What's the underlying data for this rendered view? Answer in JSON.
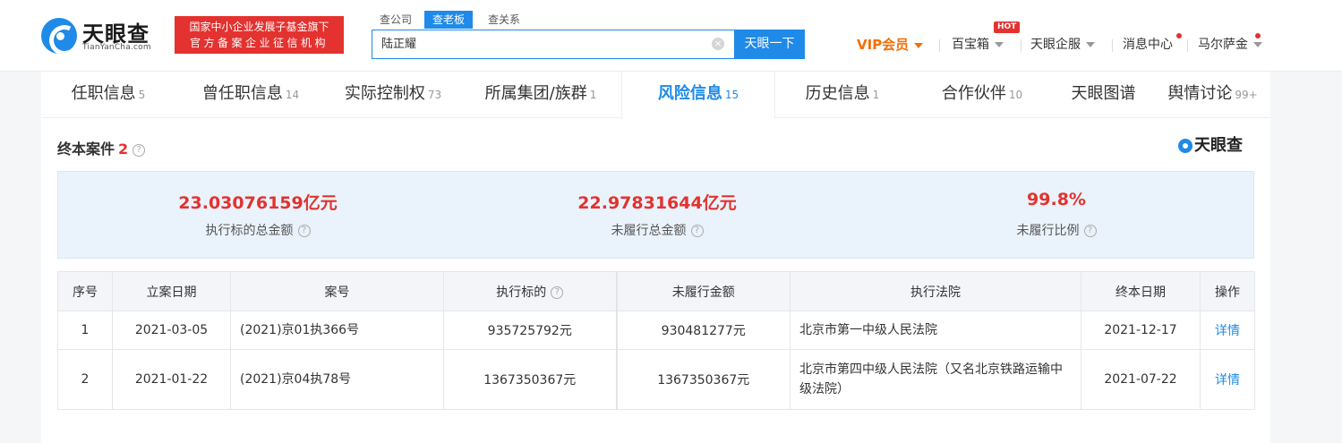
{
  "header": {
    "logo_text": "天眼查",
    "logo_sub": "TianYanCha.com",
    "badge_line1": "国家中小企业发展子基金旗下",
    "badge_line2": "官方备案企业征信机构",
    "search_tabs": [
      "查公司",
      "查老板",
      "查关系"
    ],
    "search_value": "陆正耀",
    "search_clear": "×",
    "search_button": "天眼一下",
    "nav": {
      "vip": "VIP会员",
      "toolbox": "百宝箱",
      "hot": "HOT",
      "enterprise": "天眼企服",
      "messages": "消息中心",
      "user": "马尔萨金"
    }
  },
  "tabs": [
    {
      "label": "任职信息",
      "count": "5"
    },
    {
      "label": "曾任职信息",
      "count": "14"
    },
    {
      "label": "实际控制权",
      "count": "73"
    },
    {
      "label": "所属集团/族群",
      "count": "1"
    },
    {
      "label": "风险信息",
      "count": "15"
    },
    {
      "label": "历史信息",
      "count": "1"
    },
    {
      "label": "合作伙伴",
      "count": "10"
    },
    {
      "label": "天眼图谱",
      "count": ""
    },
    {
      "label": "舆情讨论",
      "count": "99+"
    }
  ],
  "section": {
    "title": "终本案件",
    "count": "2",
    "help": "?",
    "brand": "天眼查"
  },
  "stats": [
    {
      "value": "23.03076159亿元",
      "label": "执行标的总金额"
    },
    {
      "value": "22.97831644亿元",
      "label": "未履行总金额"
    },
    {
      "value": "99.8%",
      "label": "未履行比例"
    }
  ],
  "table": {
    "headers": [
      "序号",
      "立案日期",
      "案号",
      "执行标的",
      "未履行金额",
      "执行法院",
      "终本日期",
      "操作"
    ],
    "rows": [
      {
        "no": "1",
        "date": "2021-03-05",
        "case": "(2021)京01执366号",
        "target": "935725792元",
        "unpaid": "930481277元",
        "court": "北京市第一中级人民法院",
        "end": "2021-12-17",
        "action": "详情"
      },
      {
        "no": "2",
        "date": "2021-01-22",
        "case": "(2021)京04执78号",
        "target": "1367350367元",
        "unpaid": "1367350367元",
        "court": "北京市第四中级人民法院（又名北京铁路运输中级法院）",
        "end": "2021-07-22",
        "action": "详情"
      }
    ]
  },
  "colors": {
    "brand_blue": "#1f8ae8",
    "alert_red": "#e3322f",
    "vip_orange": "#f46f06"
  },
  "icons": [
    "logo-mark-icon",
    "help-icon",
    "caret-down-icon",
    "clear-icon",
    "notification-dot-icon"
  ]
}
